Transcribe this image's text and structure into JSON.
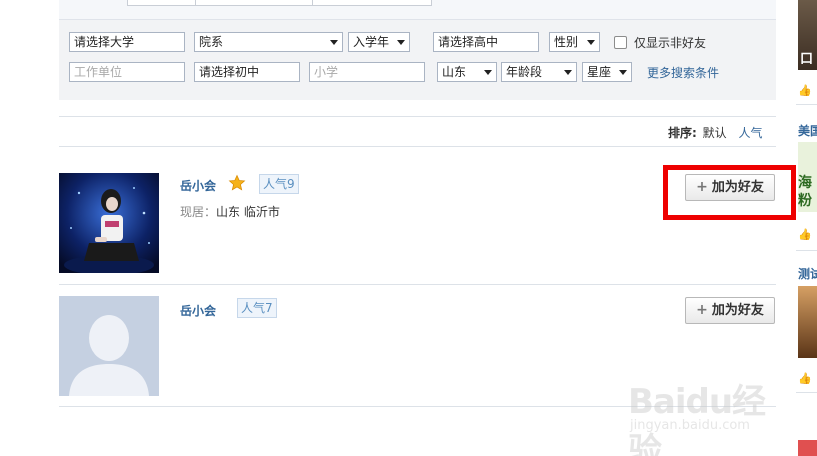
{
  "filters": {
    "university": "请选择大学",
    "department": "院系",
    "enroll_year": "入学年",
    "high_school": "请选择高中",
    "gender": "性别",
    "non_friend_only": "仅显示非好友",
    "work_unit_placeholder": "工作单位",
    "middle_school": "请选择初中",
    "primary_school_placeholder": "小学",
    "province": "山东",
    "age_range": "年龄段",
    "zodiac": "星座",
    "more_conditions": "更多搜索条件"
  },
  "sort": {
    "label": "排序:",
    "default": "默认",
    "popularity": "人气"
  },
  "results": [
    {
      "name": "岳小会",
      "popularity": "人气9",
      "location_label": "现居：",
      "location": "山东  临沂市",
      "add_button": "加为好友",
      "has_star": true
    },
    {
      "name": "岳小会",
      "popularity": "人气7",
      "add_button": "加为好友",
      "has_star": false
    }
  ],
  "right_rail": {
    "item1_title": "美国",
    "item1_text1": "海",
    "item1_text2": "粉",
    "item2_title": "测试",
    "item1_caption": "口"
  },
  "watermark": {
    "main": "Baidu经验",
    "sub": "jingyan.baidu.com"
  },
  "colors": {
    "link": "#336699",
    "highlight": "#ee0000",
    "badge_bg": "#eef4fb"
  }
}
